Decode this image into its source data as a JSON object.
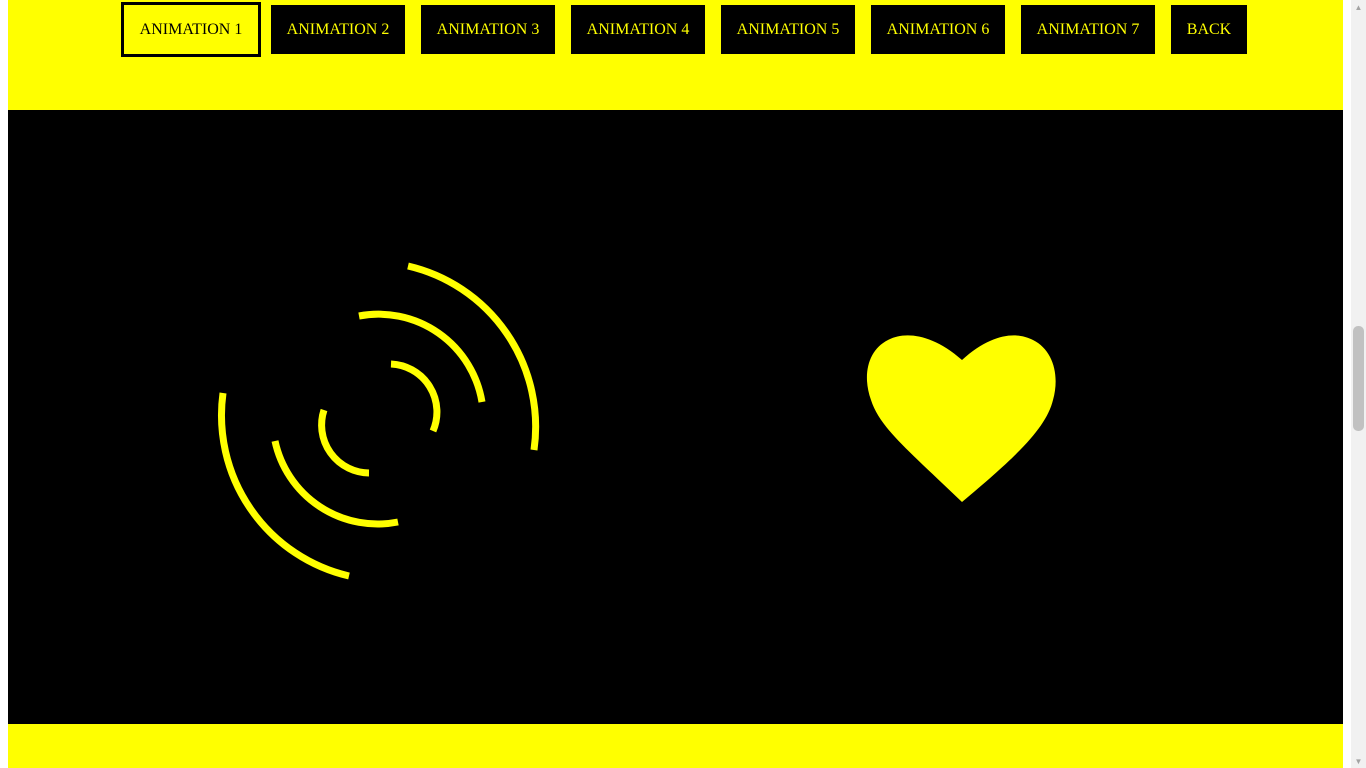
{
  "nav": {
    "buttons": [
      {
        "label": "ANIMATION 1",
        "active": true
      },
      {
        "label": "ANIMATION 2",
        "active": false
      },
      {
        "label": "ANIMATION 3",
        "active": false
      },
      {
        "label": "ANIMATION 4",
        "active": false
      },
      {
        "label": "ANIMATION 5",
        "active": false
      },
      {
        "label": "ANIMATION 6",
        "active": false
      },
      {
        "label": "ANIMATION 7",
        "active": false
      },
      {
        "label": "BACK",
        "active": false
      }
    ]
  },
  "stage": {
    "left_animation": "signal-waves-icon",
    "right_animation": "heart-icon"
  },
  "colors": {
    "accent": "#ffff00",
    "stage_background": "#000000",
    "button_background": "#000000",
    "button_text": "#ffff00"
  }
}
